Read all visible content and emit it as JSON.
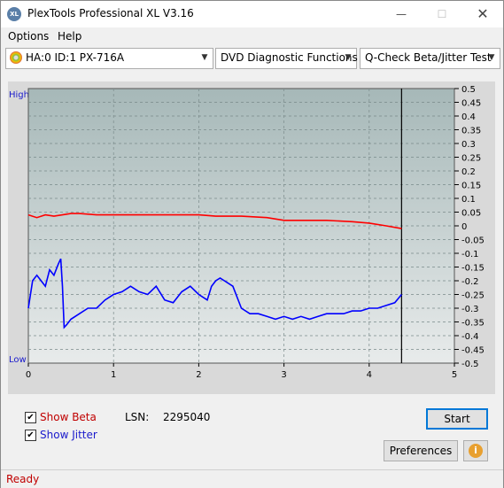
{
  "window": {
    "title": "PlexTools Professional XL V3.16",
    "icon_text": "XL",
    "controls": [
      "minimize-icon",
      "maximize-icon",
      "close-icon"
    ]
  },
  "menu": {
    "options": "Options",
    "help": "Help"
  },
  "toolbar": {
    "drive": "HA:0 ID:1  PX-716A",
    "function": "DVD Diagnostic Functions",
    "test": "Q-Check Beta/Jitter Test"
  },
  "chart_data": {
    "type": "line",
    "left_axis_top_label": "High",
    "left_axis_bottom_label": "Low",
    "x_ticks": [
      "0",
      "1",
      "2",
      "3",
      "4",
      "5"
    ],
    "xlim": [
      0,
      5
    ],
    "y_ticks": [
      "0.5",
      "0.45",
      "0.4",
      "0.35",
      "0.3",
      "0.25",
      "0.2",
      "0.15",
      "0.1",
      "0.05",
      "0",
      "-0.05",
      "-0.1",
      "-0.15",
      "-0.2",
      "-0.25",
      "-0.3",
      "-0.35",
      "-0.4",
      "-0.45",
      "-0.5"
    ],
    "ylim": [
      -0.5,
      0.5
    ],
    "grid": true,
    "end_marker_x": 4.38,
    "colors": {
      "beta": "#ff0000",
      "jitter": "#0000ff",
      "background_top": "#a6b8b8",
      "background_bottom": "#e8ebeb"
    },
    "series": [
      {
        "key": "beta",
        "x": [
          0,
          0.1,
          0.2,
          0.3,
          0.4,
          0.5,
          0.6,
          0.8,
          1.0,
          1.2,
          1.5,
          1.8,
          2.0,
          2.2,
          2.5,
          2.8,
          3.0,
          3.2,
          3.5,
          3.8,
          4.0,
          4.2,
          4.38
        ],
        "values": [
          0.04,
          0.03,
          0.04,
          0.035,
          0.04,
          0.045,
          0.045,
          0.04,
          0.04,
          0.04,
          0.04,
          0.04,
          0.04,
          0.035,
          0.035,
          0.03,
          0.02,
          0.02,
          0.02,
          0.015,
          0.01,
          0.0,
          -0.01
        ]
      },
      {
        "key": "jitter",
        "x": [
          0,
          0.05,
          0.1,
          0.15,
          0.2,
          0.25,
          0.3,
          0.35,
          0.38,
          0.4,
          0.42,
          0.45,
          0.5,
          0.6,
          0.7,
          0.8,
          0.9,
          1.0,
          1.1,
          1.2,
          1.3,
          1.4,
          1.5,
          1.6,
          1.7,
          1.8,
          1.9,
          2.0,
          2.1,
          2.15,
          2.2,
          2.25,
          2.3,
          2.4,
          2.5,
          2.6,
          2.7,
          2.8,
          2.9,
          3.0,
          3.1,
          3.2,
          3.3,
          3.4,
          3.5,
          3.6,
          3.7,
          3.8,
          3.9,
          4.0,
          4.1,
          4.2,
          4.3,
          4.38
        ],
        "values": [
          -0.3,
          -0.2,
          -0.18,
          -0.2,
          -0.22,
          -0.16,
          -0.18,
          -0.14,
          -0.12,
          -0.22,
          -0.37,
          -0.36,
          -0.34,
          -0.32,
          -0.3,
          -0.3,
          -0.27,
          -0.25,
          -0.24,
          -0.22,
          -0.24,
          -0.25,
          -0.22,
          -0.27,
          -0.28,
          -0.24,
          -0.22,
          -0.25,
          -0.27,
          -0.22,
          -0.2,
          -0.19,
          -0.2,
          -0.22,
          -0.3,
          -0.32,
          -0.32,
          -0.33,
          -0.34,
          -0.33,
          -0.34,
          -0.33,
          -0.34,
          -0.33,
          -0.32,
          -0.32,
          -0.32,
          -0.31,
          -0.31,
          -0.3,
          -0.3,
          -0.29,
          -0.28,
          -0.25
        ]
      }
    ]
  },
  "controls": {
    "show_beta": {
      "label": "Show Beta",
      "checked": true
    },
    "show_jitter": {
      "label": "Show Jitter",
      "checked": true
    },
    "lsn_label": "LSN:",
    "lsn_value": "2295040",
    "start_button": "Start",
    "preferences_button": "Preferences",
    "info_icon_text": "i"
  },
  "status": {
    "text": "Ready"
  }
}
